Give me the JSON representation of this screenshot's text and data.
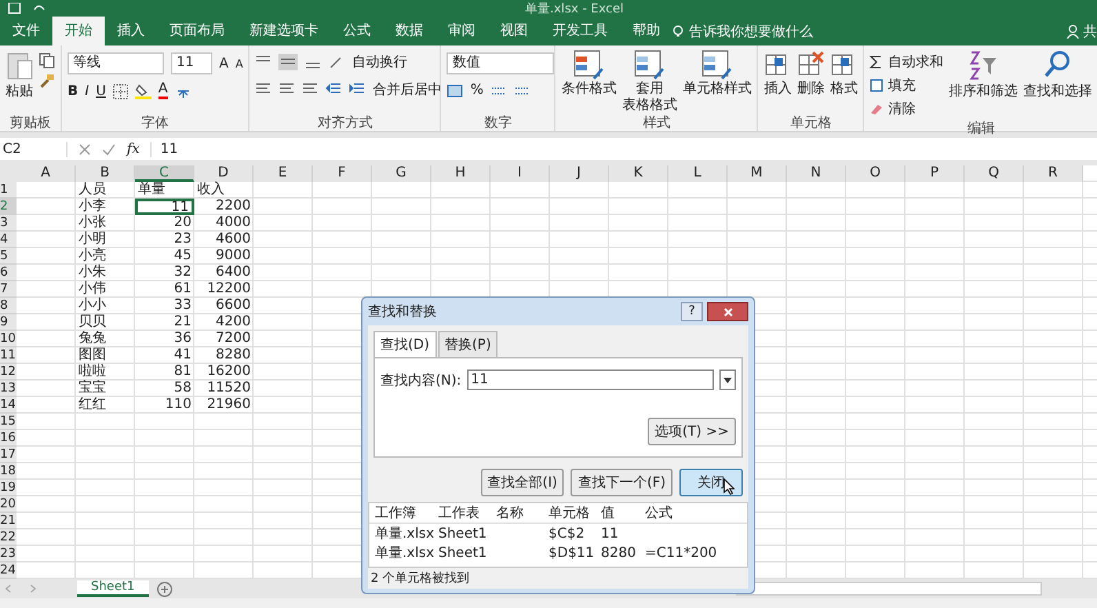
{
  "title_bar": {
    "title": "单量.xlsx - Excel"
  },
  "menu_tabs": [
    {
      "label": "文件",
      "selected": false
    },
    {
      "label": "开始",
      "selected": true
    },
    {
      "label": "插入",
      "selected": false
    },
    {
      "label": "页面布局",
      "selected": false
    },
    {
      "label": "新建选项卡",
      "selected": false
    },
    {
      "label": "公式",
      "selected": false
    },
    {
      "label": "数据",
      "selected": false
    },
    {
      "label": "审阅",
      "selected": false
    },
    {
      "label": "视图",
      "selected": false
    },
    {
      "label": "开发工具",
      "selected": false
    },
    {
      "label": "帮助",
      "selected": false
    }
  ],
  "tell_me": "告诉我你想要做什么",
  "share": "共",
  "ribbon": [
    {
      "kind": "clipboard",
      "label": "剪贴板",
      "paste": "粘贴"
    },
    {
      "kind": "font",
      "label": "字体",
      "font_name": "等线",
      "font_size": "11",
      "grow": "A",
      "shrink": "A",
      "styles": [
        "B",
        "I",
        "U"
      ],
      "font_color": "A"
    },
    {
      "kind": "alignment",
      "label": "对齐方式",
      "wrap": "自动换行",
      "merge": "合并后居中"
    },
    {
      "kind": "number",
      "label": "数字",
      "format": "数值",
      "percent": "%"
    },
    {
      "kind": "styles",
      "label": "样式",
      "buttons": [
        [
          "条件格式"
        ],
        [
          "套用",
          "表格格式"
        ],
        [
          "单元格样式"
        ]
      ]
    },
    {
      "kind": "cells",
      "label": "单元格",
      "buttons": [
        "插入",
        "删除",
        "格式"
      ]
    },
    {
      "kind": "editing",
      "label": "编辑",
      "small": [
        "自动求和",
        "填充",
        "清除"
      ],
      "large": [
        "排序和筛选",
        "查找和选择"
      ]
    }
  ],
  "formula_bar": {
    "name_box": "C2",
    "fx": "fx",
    "value": "11"
  },
  "sheet": {
    "columns": [
      {
        "label": "A",
        "selected": false
      },
      {
        "label": "B",
        "selected": false
      },
      {
        "label": "C",
        "selected": true
      },
      {
        "label": "D",
        "selected": false
      },
      {
        "label": "E",
        "selected": false
      },
      {
        "label": "F",
        "selected": false
      },
      {
        "label": "G",
        "selected": false
      },
      {
        "label": "H",
        "selected": false
      },
      {
        "label": "I",
        "selected": false
      },
      {
        "label": "J",
        "selected": false
      },
      {
        "label": "K",
        "selected": false
      },
      {
        "label": "L",
        "selected": false
      },
      {
        "label": "M",
        "selected": false
      },
      {
        "label": "N",
        "selected": false
      },
      {
        "label": "O",
        "selected": false
      },
      {
        "label": "P",
        "selected": false
      },
      {
        "label": "Q",
        "selected": false
      },
      {
        "label": "R",
        "selected": false
      }
    ],
    "rows": [
      {
        "label": "1",
        "selected": false,
        "cells": [
          {
            "text": "人员",
            "selected": false
          },
          {
            "text": "单量",
            "selected": false
          },
          {
            "text": "收入",
            "selected": false
          }
        ]
      },
      {
        "label": "2",
        "selected": true,
        "cells": [
          {
            "text": "小李",
            "selected": false
          },
          {
            "text": "11",
            "selected": true
          },
          {
            "text": "2200",
            "selected": false
          }
        ]
      },
      {
        "label": "3",
        "selected": false,
        "cells": [
          {
            "text": "小张",
            "selected": false
          },
          {
            "text": "20",
            "selected": false
          },
          {
            "text": "4000",
            "selected": false
          }
        ]
      },
      {
        "label": "4",
        "selected": false,
        "cells": [
          {
            "text": "小明",
            "selected": false
          },
          {
            "text": "23",
            "selected": false
          },
          {
            "text": "4600",
            "selected": false
          }
        ]
      },
      {
        "label": "5",
        "selected": false,
        "cells": [
          {
            "text": "小亮",
            "selected": false
          },
          {
            "text": "45",
            "selected": false
          },
          {
            "text": "9000",
            "selected": false
          }
        ]
      },
      {
        "label": "6",
        "selected": false,
        "cells": [
          {
            "text": "小朱",
            "selected": false
          },
          {
            "text": "32",
            "selected": false
          },
          {
            "text": "6400",
            "selected": false
          }
        ]
      },
      {
        "label": "7",
        "selected": false,
        "cells": [
          {
            "text": "小伟",
            "selected": false
          },
          {
            "text": "61",
            "selected": false
          },
          {
            "text": "12200",
            "selected": false
          }
        ]
      },
      {
        "label": "8",
        "selected": false,
        "cells": [
          {
            "text": "小小",
            "selected": false
          },
          {
            "text": "33",
            "selected": false
          },
          {
            "text": "6600",
            "selected": false
          }
        ]
      },
      {
        "label": "9",
        "selected": false,
        "cells": [
          {
            "text": "贝贝",
            "selected": false
          },
          {
            "text": "21",
            "selected": false
          },
          {
            "text": "4200",
            "selected": false
          }
        ]
      },
      {
        "label": "10",
        "selected": false,
        "cells": [
          {
            "text": "兔兔",
            "selected": false
          },
          {
            "text": "36",
            "selected": false
          },
          {
            "text": "7200",
            "selected": false
          }
        ]
      },
      {
        "label": "11",
        "selected": false,
        "cells": [
          {
            "text": "图图",
            "selected": false
          },
          {
            "text": "41",
            "selected": false
          },
          {
            "text": "8280",
            "selected": false
          }
        ]
      },
      {
        "label": "12",
        "selected": false,
        "cells": [
          {
            "text": "啦啦",
            "selected": false
          },
          {
            "text": "81",
            "selected": false
          },
          {
            "text": "16200",
            "selected": false
          }
        ]
      },
      {
        "label": "13",
        "selected": false,
        "cells": [
          {
            "text": "宝宝",
            "selected": false
          },
          {
            "text": "58",
            "selected": false
          },
          {
            "text": "11520",
            "selected": false
          }
        ]
      },
      {
        "label": "14",
        "selected": false,
        "cells": [
          {
            "text": "红红",
            "selected": false
          },
          {
            "text": "110",
            "selected": false
          },
          {
            "text": "21960",
            "selected": false
          }
        ]
      },
      {
        "label": "15",
        "selected": false
      },
      {
        "label": "16",
        "selected": false
      },
      {
        "label": "17",
        "selected": false
      },
      {
        "label": "18",
        "selected": false
      },
      {
        "label": "19",
        "selected": false
      },
      {
        "label": "20",
        "selected": false
      },
      {
        "label": "21",
        "selected": false
      },
      {
        "label": "22",
        "selected": false
      },
      {
        "label": "23",
        "selected": false
      },
      {
        "label": "24",
        "selected": false
      }
    ]
  },
  "sheet_tabs": [
    {
      "label": "Sheet1",
      "selected": true
    }
  ],
  "dialog": {
    "title": "查找和替换",
    "help": "?",
    "tabs": [
      {
        "label": "查找(D)",
        "selected": true
      },
      {
        "label": "替换(P)",
        "selected": false
      }
    ],
    "find_label": "查找内容(N):",
    "find_value": "11",
    "options_button": "选项(T) >>",
    "buttons": [
      {
        "label": "查找全部(I)",
        "focused": false
      },
      {
        "label": "查找下一个(F)",
        "focused": false
      },
      {
        "label": "关闭",
        "focused": true
      }
    ],
    "result_columns": [
      "工作簿",
      "工作表",
      "名称",
      "单元格",
      "值",
      "公式"
    ],
    "results": [
      {
        "workbook": "单量.xlsx",
        "sheet": "Sheet1",
        "cell": "$C$2",
        "value": "11"
      },
      {
        "workbook": "单量.xlsx",
        "sheet": "Sheet1",
        "cell": "$D$11",
        "value": "8280",
        "formula": "=C11*200"
      }
    ],
    "status": "2 个单元格被找到"
  }
}
